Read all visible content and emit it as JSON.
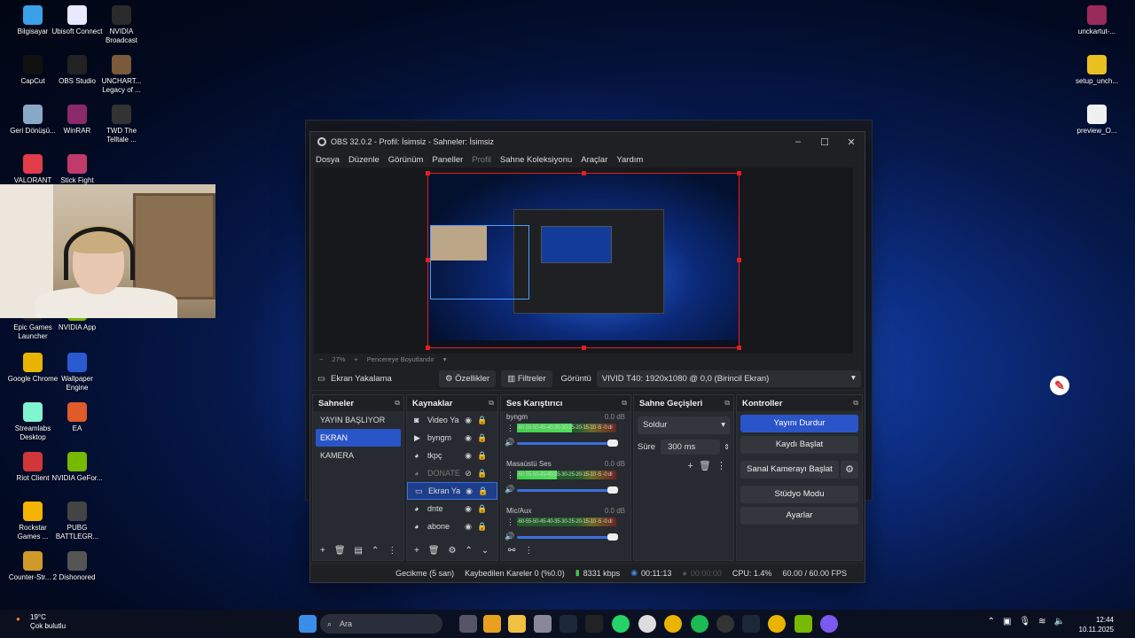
{
  "desktop": {
    "left_icons": [
      {
        "label": "Bilgisayar",
        "icon": "computer-icon",
        "color": "#3aa0e8"
      },
      {
        "label": "Ubisoft Connect",
        "icon": "ubisoft-icon",
        "color": "#e8e8ff"
      },
      {
        "label": "NVIDIA Broadcast",
        "icon": "nvidia-icon",
        "color": "#2a2a2a"
      },
      {
        "label": "CapCut",
        "icon": "capcut-icon",
        "color": "#111"
      },
      {
        "label": "OBS Studio",
        "icon": "obs-icon",
        "color": "#222"
      },
      {
        "label": "UNCHART... Legacy of ...",
        "icon": "uncharted-icon",
        "color": "#7a5a3a"
      },
      {
        "label": "Geri Dönüşü...",
        "icon": "recycle-bin-icon",
        "color": "#8aa8c8"
      },
      {
        "label": "WinRAR",
        "icon": "winrar-icon",
        "color": "#8a2a6a"
      },
      {
        "label": "TWD The Telltale ...",
        "icon": "twd-icon",
        "color": "#333"
      },
      {
        "label": "VALORANT",
        "icon": "valorant-icon",
        "color": "#e23b4a"
      },
      {
        "label": "Stick Fight",
        "icon": "stickfight-icon",
        "color": "#c03a6a"
      },
      {
        "label": "Epic Games Launcher",
        "icon": "epic-icon",
        "color": "#222"
      },
      {
        "label": "NVIDIA App",
        "icon": "nvidia-app-icon",
        "color": "#76b900"
      },
      {
        "label": "Google Chrome",
        "icon": "chrome-icon",
        "color": "#e9b400"
      },
      {
        "label": "Wallpaper Engine",
        "icon": "wallpaper-engine-icon",
        "color": "#2a5ad0"
      },
      {
        "label": "Streamlabs Desktop",
        "icon": "streamlabs-icon",
        "color": "#80f5d2"
      },
      {
        "label": "EA",
        "icon": "ea-icon",
        "color": "#e05a2a"
      },
      {
        "label": "Riot Client",
        "icon": "riot-icon",
        "color": "#d13639"
      },
      {
        "label": "NVIDIA GeFor...",
        "icon": "geforce-icon",
        "color": "#76b900"
      },
      {
        "label": "Rockstar Games ...",
        "icon": "rockstar-icon",
        "color": "#f5b400"
      },
      {
        "label": "PUBG BATTLEGR...",
        "icon": "pubg-icon",
        "color": "#444"
      },
      {
        "label": "Counter-Str... 2",
        "icon": "cs2-icon",
        "color": "#d09a2a"
      },
      {
        "label": "Dishonored",
        "icon": "dishonored-icon",
        "color": "#555"
      }
    ],
    "right_icons": [
      {
        "label": "unckartut-...",
        "icon": "winrar-archive-icon",
        "color": "#9a2a5a"
      },
      {
        "label": "setup_unch...",
        "icon": "setup-disc-icon",
        "color": "#e8c020"
      },
      {
        "label": "preview_O...",
        "icon": "file-icon",
        "color": "#f0f0f0"
      }
    ]
  },
  "obs": {
    "title": "OBS 32.0.2 - Profil: İsimsiz - Sahneler: İsimsiz",
    "menu": [
      "Dosya",
      "Düzenle",
      "Görünüm",
      "Paneller",
      "Profil",
      "Sahne Koleksiyonu",
      "Araçlar",
      "Yardım"
    ],
    "zoom": "27%",
    "fit_label": "Pencereye Boyutlandır",
    "source_bar": {
      "current_source": "Ekran Yakalama",
      "properties": "Özellikler",
      "filters": "Filtreler",
      "display_label": "Görüntü",
      "display_value": "VIVID T40: 1920x1080 @ 0,0 (Birincil Ekran)"
    },
    "scenes": {
      "title": "Sahneler",
      "items": [
        "YAYIN BAŞLIYOR",
        "EKRAN",
        "KAMERA"
      ]
    },
    "sources": {
      "title": "Kaynaklar",
      "items": [
        "Video Ya",
        "byngm",
        "tkpç",
        "DONATE",
        "Ekran Ya",
        "dnte",
        "abone"
      ]
    },
    "mixer": {
      "title": "Ses Karıştırıcı",
      "tracks": [
        {
          "name": "byngm",
          "db": "0.0 dB",
          "level": 0.55
        },
        {
          "name": "Masaüstü Ses",
          "db": "0.0 dB",
          "level": 0.4
        },
        {
          "name": "Mic/Aux",
          "db": "0.0 dB",
          "level": 0.0
        }
      ],
      "ticks": "-60-55-50-45-40-35-30-25-20-15-10 -5 -0 dl"
    },
    "transitions": {
      "title": "Sahne Geçişleri",
      "type": "Soldur",
      "duration_label": "Süre",
      "duration": "300 ms"
    },
    "controls": {
      "title": "Kontroller",
      "stop_stream": "Yayını Durdur",
      "start_record": "Kaydı Başlat",
      "virtual_cam": "Sanal Kamerayı Başlat",
      "studio_mode": "Stüdyo Modu",
      "settings": "Ayarlar"
    },
    "status": {
      "delay": "Gecikme (5 san)",
      "dropped": "Kaybedilen Kareler 0 (%0.0)",
      "bitrate": "8331 kbps",
      "stream_time": "00:11:13",
      "record_time": "00:00:00",
      "cpu": "CPU: 1.4%",
      "fps": "60.00 / 60.00 FPS"
    }
  },
  "taskbar": {
    "weather_temp": "19°C",
    "weather_desc": "Çok bulutlu",
    "search_placeholder": "Ara",
    "time": "12:44",
    "date": "10.11.2025"
  }
}
